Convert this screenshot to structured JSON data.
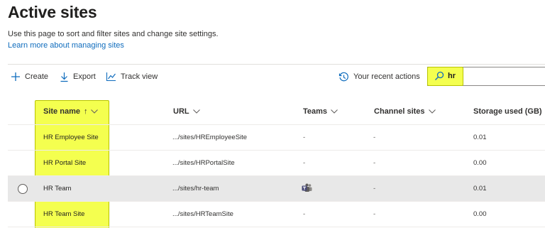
{
  "page": {
    "title": "Active sites",
    "description": "Use this page to sort and filter sites and change site settings.",
    "learn_link": "Learn more about managing sites"
  },
  "toolbar": {
    "create_label": "Create",
    "export_label": "Export",
    "track_label": "Track view",
    "recent_label": "Your recent actions"
  },
  "search": {
    "value": "hr"
  },
  "columns": {
    "site_name": "Site name",
    "url": "URL",
    "teams": "Teams",
    "channel_sites": "Channel sites",
    "storage": "Storage used (GB)"
  },
  "rows": [
    {
      "name": "HR Employee Site",
      "url": ".../sites/HREmployeeSite",
      "teams": "-",
      "channel": "-",
      "storage": "0.01"
    },
    {
      "name": "HR Portal Site",
      "url": ".../sites/HRPortalSite",
      "teams": "-",
      "channel": "-",
      "storage": "0.00"
    },
    {
      "name": "HR Team",
      "url": ".../sites/hr-team",
      "teams": "teams-icon",
      "channel": "-",
      "storage": "0.01",
      "selected": true
    },
    {
      "name": "HR Team Site",
      "url": ".../sites/HRTeamSite",
      "teams": "-",
      "channel": "-",
      "storage": "0.00"
    }
  ],
  "colors": {
    "accent": "#0f6cbd",
    "highlight": "#f4ff4f",
    "selected_row": "#e8e8e8"
  }
}
